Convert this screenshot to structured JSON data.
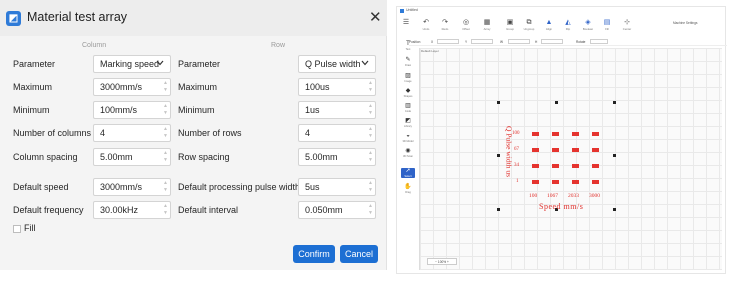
{
  "dialog": {
    "title": "Material test array",
    "column_header": "Column",
    "row_header": "Row",
    "rows": [
      {
        "left_label": "Parameter",
        "left_value": "Marking speed",
        "right_label": "Parameter",
        "right_value": "Q Pulse width"
      },
      {
        "left_label": "Maximum",
        "left_value": "3000mm/s",
        "right_label": "Maximum",
        "right_value": "100us"
      },
      {
        "left_label": "Minimum",
        "left_value": "100mm/s",
        "right_label": "Minimum",
        "right_value": "1us"
      },
      {
        "left_label": "Number of columns",
        "left_value": "4",
        "right_label": "Number of rows",
        "right_value": "4"
      },
      {
        "left_label": "Column spacing",
        "left_value": "5.00mm",
        "right_label": "Row spacing",
        "right_value": "5.00mm"
      },
      {
        "left_label": "Default speed",
        "left_value": "3000mm/s",
        "right_label": "Default processing pulse width",
        "right_value": "5us"
      },
      {
        "left_label": "Default frequency",
        "left_value": "30.00kHz",
        "right_label": "Default interval",
        "right_value": "0.050mm"
      }
    ],
    "fill_label": "Fill",
    "fill_checked": false,
    "confirm_label": "Confirm",
    "cancel_label": "Cancel",
    "accent_color": "#1d6fd3"
  },
  "app": {
    "title": "Untitled",
    "toolbar": [
      {
        "icon": "undo-icon",
        "glyph": "↶",
        "label": "Undo"
      },
      {
        "icon": "redo-icon",
        "glyph": "↷",
        "label": "Redo"
      },
      {
        "icon": "offset-icon",
        "glyph": "◎",
        "label": "Offset"
      },
      {
        "icon": "array-icon",
        "glyph": "▦",
        "label": "Array"
      },
      {
        "icon": "group-icon",
        "glyph": "▣",
        "label": "Group"
      },
      {
        "icon": "ungroup-icon",
        "glyph": "⧉",
        "label": "Ungroup"
      },
      {
        "icon": "align-icon",
        "glyph": "▲",
        "label": "Align"
      },
      {
        "icon": "flip-icon",
        "glyph": "◭",
        "label": "Flip"
      },
      {
        "icon": "boolean-icon",
        "glyph": "◈",
        "label": "Boolean"
      },
      {
        "icon": "fill-icon",
        "glyph": "▤",
        "label": "Fill"
      },
      {
        "icon": "center-icon",
        "glyph": "⊹",
        "label": "Center"
      }
    ],
    "right_label": "Machine Settings",
    "propbar": {
      "position_label": "Position",
      "x_label": "X",
      "y_label": "Y",
      "w_label": "W",
      "h_label": "H",
      "rotate_label": "Rotate"
    },
    "sidebar": [
      {
        "icon": "text-icon",
        "glyph": "T",
        "label": "Text"
      },
      {
        "icon": "pen-icon",
        "glyph": "✎",
        "label": "Draw"
      },
      {
        "icon": "image-icon",
        "glyph": "▨",
        "label": "Image"
      },
      {
        "icon": "shape-icon",
        "glyph": "◆",
        "label": "Shapes"
      },
      {
        "icon": "code-icon",
        "glyph": "▥",
        "label": "Code"
      },
      {
        "icon": "material-icon",
        "glyph": "◩",
        "label": "Library"
      },
      {
        "icon": "3d-icon",
        "glyph": "◒",
        "label": "3D Model"
      },
      {
        "icon": "scan-icon",
        "glyph": "◉",
        "label": "3D Scan"
      },
      {
        "icon": "select-icon",
        "glyph": "➚",
        "label": "Select"
      },
      {
        "icon": "hand-icon",
        "glyph": "✋",
        "label": "Drag"
      }
    ],
    "layer_label": "Default Layer",
    "zoom_label": "100%",
    "array_preview": {
      "y_axis_label": "Q Pulse width us",
      "x_axis_label": "Speed mm/s",
      "row_values": [
        "100",
        "67",
        "34",
        "1"
      ],
      "col_values": [
        "100",
        "1067",
        "2033",
        "3000"
      ]
    }
  }
}
